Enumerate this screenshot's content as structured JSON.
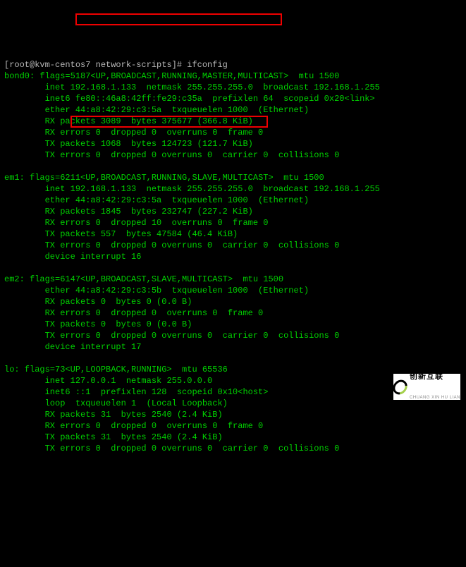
{
  "prompt": {
    "user_host": "[root@kvm-centos7 network-scripts]# ",
    "command": "ifconfig"
  },
  "bond0": {
    "header_pre": "bond0: flags=5187",
    "header_flags": "<UP,BROADCAST,RUNNING,MASTER,MULTICAST>",
    "header_post": "  mtu 1500",
    "l2": "        inet 192.168.1.133  netmask 255.255.255.0  broadcast 192.168.1.255",
    "l3": "        inet6 fe80::46a8:42ff:fe29:c35a  prefixlen 64  scopeid 0x20<link>",
    "l4": "        ether 44:a8:42:29:c3:5a  txqueuelen 1000  (Ethernet)",
    "l5": "        RX packets 3089  bytes 375677 (366.8 KiB)",
    "l6": "        RX errors 0  dropped 0  overruns 0  frame 0",
    "l7": "        TX packets 1068  bytes 124723 (121.7 KiB)",
    "l8": "        TX errors 0  dropped 0 overruns 0  carrier 0  collisions 0"
  },
  "em1": {
    "header_pre": "em1: flags=6211",
    "header_flags": "<UP,BROADCAST,RUNNING,SLAVE,MULTICAST>",
    "header_post": "  mtu 1500",
    "l2": "        inet 192.168.1.133  netmask 255.255.255.0  broadcast 192.168.1.255",
    "l3": "        ether 44:a8:42:29:c3:5a  txqueuelen 1000  (Ethernet)",
    "l4": "        RX packets 1845  bytes 232747 (227.2 KiB)",
    "l5": "        RX errors 0  dropped 10  overruns 0  frame 0",
    "l6": "        TX packets 557  bytes 47584 (46.4 KiB)",
    "l7": "        TX errors 0  dropped 0 overruns 0  carrier 0  collisions 0",
    "l8": "        device interrupt 16"
  },
  "em2": {
    "l1": "em2: flags=6147<UP,BROADCAST,SLAVE,MULTICAST>  mtu 1500",
    "l2": "        ether 44:a8:42:29:c3:5b  txqueuelen 1000  (Ethernet)",
    "l3": "        RX packets 0  bytes 0 (0.0 B)",
    "l4": "        RX errors 0  dropped 0  overruns 0  frame 0",
    "l5": "        TX packets 0  bytes 0 (0.0 B)",
    "l6": "        TX errors 0  dropped 0 overruns 0  carrier 0  collisions 0",
    "l7": "        device interrupt 17"
  },
  "lo": {
    "l1": "lo: flags=73<UP,LOOPBACK,RUNNING>  mtu 65536",
    "l2": "        inet 127.0.0.1  netmask 255.0.0.0",
    "l3": "        inet6 ::1  prefixlen 128  scopeid 0x10<host>",
    "l4": "        loop  txqueuelen 1  (Local Loopback)",
    "l5": "        RX packets 31  bytes 2540 (2.4 KiB)",
    "l6": "        RX errors 0  dropped 0  overruns 0  frame 0",
    "l7": "        TX packets 31  bytes 2540 (2.4 KiB)",
    "l8": "        TX errors 0  dropped 0 overruns 0  carrier 0  collisions 0"
  },
  "logo": {
    "cn": "创新互联",
    "en": "CHUANG XIN HU LIAN"
  }
}
